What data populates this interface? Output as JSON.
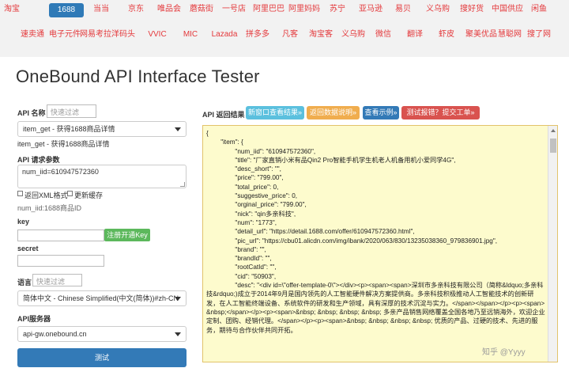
{
  "nav": {
    "row1": [
      "淘宝",
      "1688",
      "当当",
      "京东",
      "唯品会",
      "蘑菇街",
      "一号店",
      "阿里巴巴",
      "阿里妈妈",
      "苏宁",
      "亚马逊",
      "易贝",
      "义乌购",
      "搜好货",
      "中国供应",
      "闲鱼"
    ],
    "row2": [
      "速卖通",
      "电子元件",
      "网易考拉",
      "洋码头",
      "VVIC",
      "MIC",
      "Lazada",
      "拼多多",
      "凡客",
      "淘宝客",
      "义乌购",
      "微信",
      "翻译",
      "虾皮",
      "聚美优品",
      "慧聪网",
      "搜了网"
    ],
    "active": "1688"
  },
  "page_title": "OneBound API Interface Tester",
  "left": {
    "api_name_label": "API 名称",
    "api_filter_placeholder": "快速过滤",
    "api_select_value": "item_get - 获得1688商品详情",
    "api_desc": "item_get - 获得1688商品详情",
    "request_params_label": "API 请求参数",
    "request_params_value": "num_iid=610947572360",
    "return_xml_label": "返回XML格式",
    "update_cache_label": "更新缓存",
    "param_hint": "num_iid:1688商品ID",
    "key_label": "key",
    "register_key_button": "注册开通Key",
    "secret_label": "secret",
    "language_label": "语言",
    "language_filter_placeholder": "快速过滤",
    "language_select_value": "简体中文 - Chinese Simplified(中文(简体))#zh-CN",
    "server_label": "API服务器",
    "server_select_value": "api-gw.onebound.cn",
    "test_button": "测试"
  },
  "right": {
    "result_label": "API 返回结果",
    "buttons": [
      {
        "label": "新窗口查看结果»",
        "color": "#5bc0de"
      },
      {
        "label": "返回数据说明»",
        "color": "#f0ad4e"
      },
      {
        "label": "查看示例»",
        "color": "#337ab7"
      },
      {
        "label": "测试报错？提交工单»",
        "color": "#d9534f"
      }
    ],
    "result_text": "{\n\t\"item\": {\n\t\t\"num_iid\": \"610947572360\",\n\t\t\"title\": \"厂家直销小米有品Qin2 Pro智能手机学生机老人机备用机小爱同学4G\",\n\t\t\"desc_short\": \"\",\n\t\t\"price\": \"799.00\",\n\t\t\"total_price\": 0,\n\t\t\"suggestive_price\": 0,\n\t\t\"orginal_price\": \"799.00\",\n\t\t\"nick\": \"qin多亲科技\",\n\t\t\"num\": \"1773\",\n\t\t\"detail_url\": \"https://detail.1688.com/offer/610947572360.html\",\n\t\t\"pic_url\": \"https://cbu01.alicdn.com/img/ibank/2020/063/830/13235038360_979836901.jpg\",\n\t\t\"brand\": \"\",\n\t\t\"brandId\": \"\",\n\t\t\"rootCatId\": \"\",\n\t\t\"cid\": \"50903\",\n\t\t\"desc\": \"<div id=\\\"offer-template-0\\\"></div><p><span><span>深圳市多亲科技有限公司（简称&ldquo;多亲科技&rdquo;)成立于2014年9月是国内领先的人工智能硬件解决方案提供商。多亲科技积极推动人工智能技术的创新研发，在人工智能终端设备、系统软件的研发和生产领域，具有深厚的技术沉淀与实力。</span></span></p><p><span>&nbsp;</span></p><p><span>&nbsp; &nbsp; &nbsp; &nbsp; 多亲产品销售网络覆盖全国各地乃至远销海外，欢迎企业定制、团购、经销代理。</span></p><p><span>&nbsp; &nbsp; &nbsp; &nbsp; 优质的产品、过硬的技术、先进的服务，期待与合作伙伴共同开拓。"
  },
  "watermark": "知乎 @Yyyy"
}
